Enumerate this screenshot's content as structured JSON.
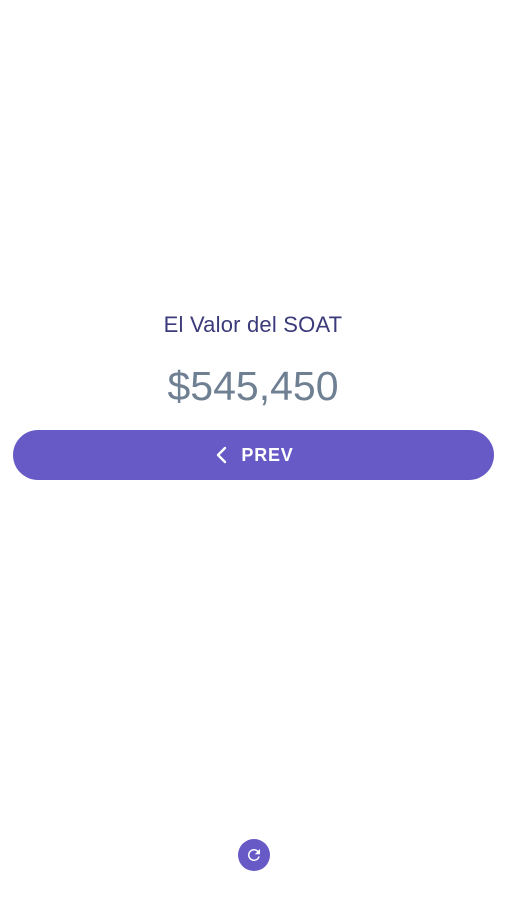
{
  "soat": {
    "label": "El Valor del SOAT",
    "value": "$545,450"
  },
  "navigation": {
    "prev_label": "PREV",
    "prev_icon": "chevron-left-icon"
  },
  "footer": {
    "refresh_icon": "refresh-icon"
  },
  "colors": {
    "accent": "#675ac6",
    "label_text": "#3b3a7a",
    "value_text": "#6f8093",
    "background": "#ffffff"
  }
}
